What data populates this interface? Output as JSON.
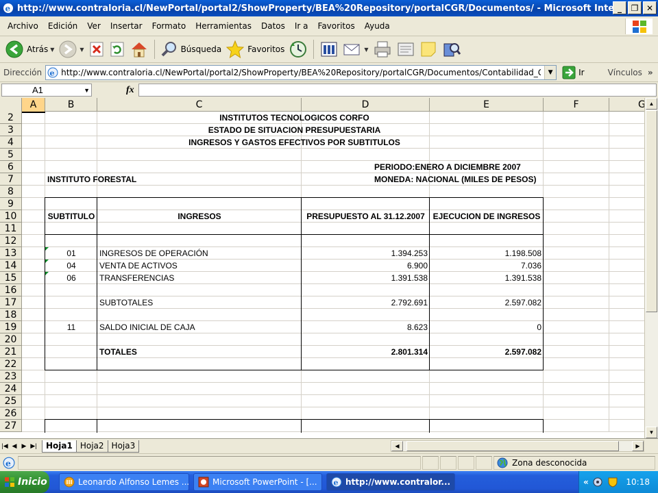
{
  "window": {
    "title": "http://www.contraloria.cl/NewPortal/portal2/ShowProperty/BEA%20Repository/portalCGR/Documentos/ - Microsoft Internet...",
    "minimize_label": "_",
    "maximize_label": "❐",
    "close_label": "✕"
  },
  "menu": [
    "Archivo",
    "Edición",
    "Ver",
    "Insertar",
    "Formato",
    "Herramientas",
    "Datos",
    "Ir a",
    "Favoritos",
    "Ayuda"
  ],
  "toolbar": {
    "back_label": "Atrás",
    "search_label": "Búsqueda",
    "favorites_label": "Favoritos"
  },
  "address": {
    "label": "Dirección",
    "value": "http://www.contraloria.cl/NewPortal/portal2/ShowProperty/BEA%20Repository/portalCGR/Documentos/Contabilidad_Ger",
    "go_label": "Ir",
    "links_label": "Vínculos"
  },
  "formula_bar": {
    "name_box": "A1",
    "fx": "fx"
  },
  "columns": [
    "A",
    "B",
    "C",
    "D",
    "E",
    "F",
    "G"
  ],
  "rows": [
    "2",
    "3",
    "4",
    "5",
    "6",
    "7",
    "8",
    "9",
    "10",
    "11",
    "12",
    "13",
    "14",
    "15",
    "16",
    "17",
    "18",
    "19",
    "20",
    "21",
    "22",
    "23",
    "24",
    "25",
    "26",
    "27"
  ],
  "report": {
    "title1": "INSTITUTOS TECNOLOGICOS CORFO",
    "title2": "ESTADO DE SITUACION PRESUPUESTARIA",
    "title3": "INGRESOS Y GASTOS EFECTIVOS  POR SUBTITULOS",
    "periodo": "PERIODO:ENERO A DICIEMBRE  2007",
    "institute": "INSTITUTO FORESTAL",
    "moneda": "MONEDA: NACIONAL (MILES DE PESOS)",
    "headers": {
      "subtitulo": "SUBTITULO",
      "ingresos": "INGRESOS",
      "presupuesto": "PRESUPUESTO AL 31.12.2007",
      "ejecucion": "EJECUCION DE INGRESOS"
    },
    "lines": [
      {
        "code": "01",
        "name": "INGRESOS DE OPERACIÓN",
        "presupuesto": "1.394.253",
        "ejecucion": "1.198.508"
      },
      {
        "code": "04",
        "name": "VENTA DE ACTIVOS",
        "presupuesto": "6.900",
        "ejecucion": "7.036"
      },
      {
        "code": "06",
        "name": "TRANSFERENCIAS",
        "presupuesto": "1.391.538",
        "ejecucion": "1.391.538"
      }
    ],
    "subtotal": {
      "name": "SUBTOTALES",
      "presupuesto": "2.792.691",
      "ejecucion": "2.597.082"
    },
    "saldo": {
      "code": "11",
      "name": "SALDO INICIAL DE CAJA",
      "presupuesto": "8.623",
      "ejecucion": "0"
    },
    "total": {
      "name": "TOTALES",
      "presupuesto": "2.801.314",
      "ejecucion": "2.597.082"
    }
  },
  "sheet_tabs": [
    "Hoja1",
    "Hoja2",
    "Hoja3"
  ],
  "status": {
    "zone": "Zona desconocida"
  },
  "taskbar": {
    "start": "Inicio",
    "tasks": [
      "Leonardo Alfonso Lemes ...",
      "Microsoft PowerPoint - [...",
      "http://www.contralor..."
    ],
    "tray_chevron": "«",
    "clock": "10:18"
  },
  "colors": {
    "titlebar": "#0842a8",
    "selected_header": "#ffd58a",
    "taskbar": "#245edb",
    "start": "#2f8f2f"
  }
}
